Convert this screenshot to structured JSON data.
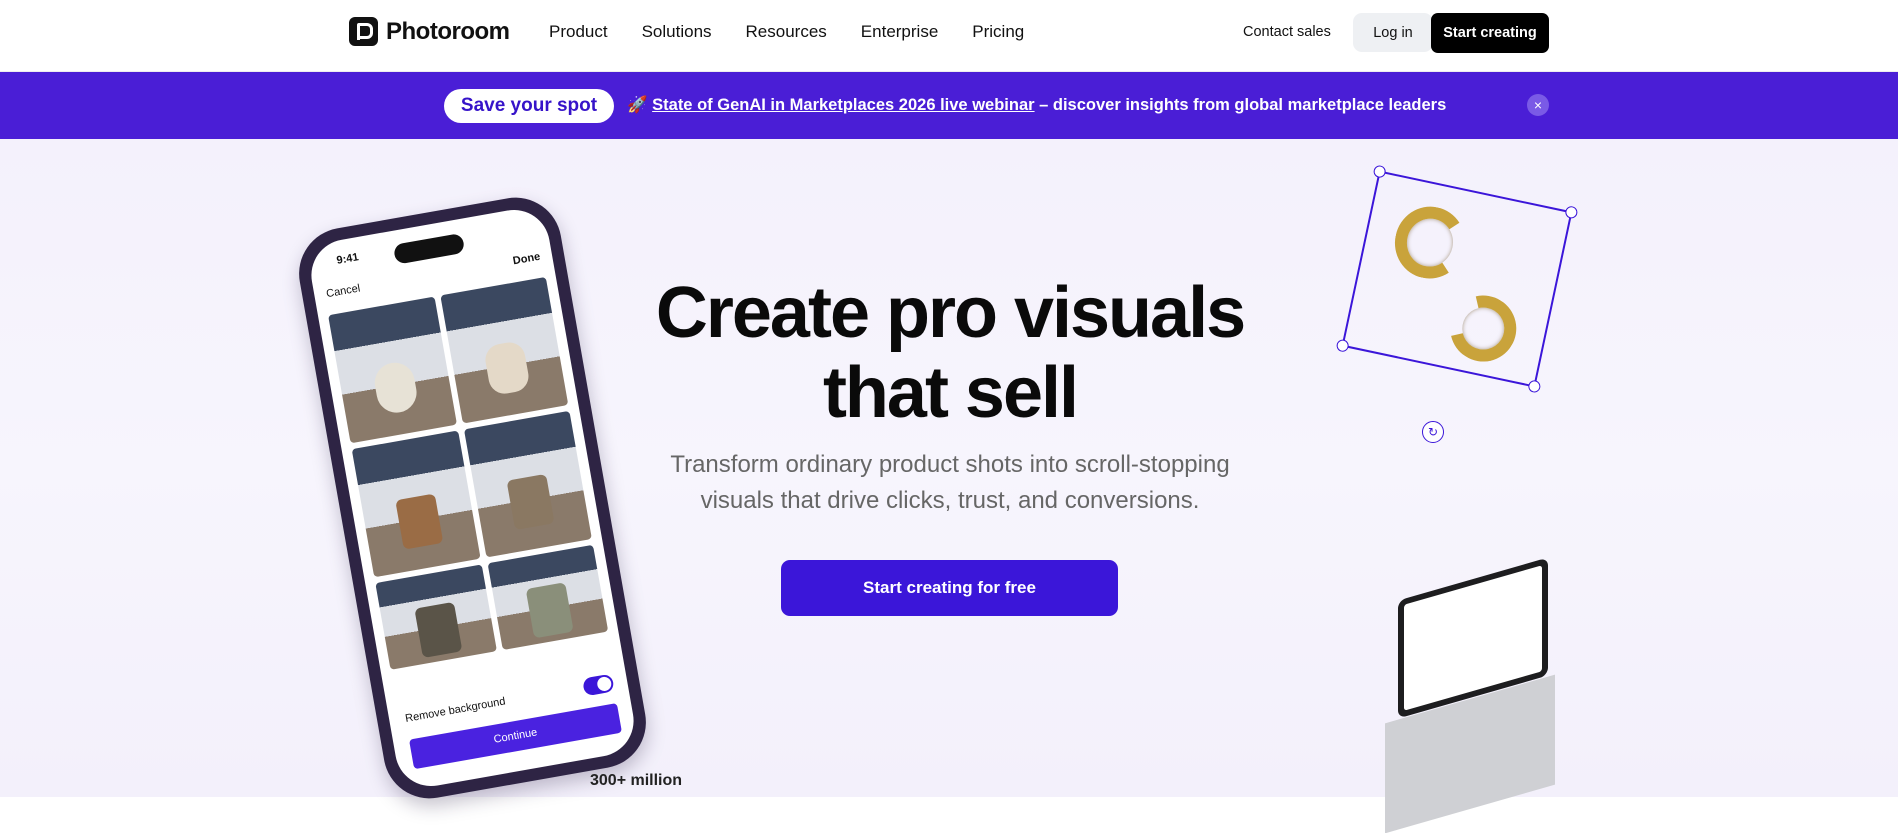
{
  "nav": {
    "brand": "Photoroom",
    "items": [
      "Product",
      "Solutions",
      "Resources",
      "Enterprise",
      "Pricing"
    ],
    "contact": "Contact sales",
    "login": "Log in",
    "start": "Start creating"
  },
  "banner": {
    "badge": "Save your spot",
    "emoji": "🚀",
    "link": "State of GenAI in Marketplaces 2026 live webinar",
    "rest": " – discover insights from global marketplace leaders",
    "close": "×"
  },
  "hero": {
    "title_line1": "Create pro visuals",
    "title_line2": "that sell",
    "subtitle_line1": "Transform ordinary product shots into scroll-stopping",
    "subtitle_line2": "visuals that drive clicks, trust, and conversions.",
    "cta": "Start creating for free"
  },
  "phone": {
    "time": "9:41",
    "cancel": "Cancel",
    "done": "Done",
    "toggle_label": "Remove background",
    "continue": "Continue",
    "tile_colors": [
      "#e7e2d6",
      "#e4d9c8",
      "#9a6c45",
      "#8a7862",
      "#5a5448",
      "#8a8f7a"
    ]
  },
  "stats": {
    "users": "300+ million"
  },
  "colors": {
    "accent": "#4a1ed6",
    "cta": "#3b16d9"
  }
}
